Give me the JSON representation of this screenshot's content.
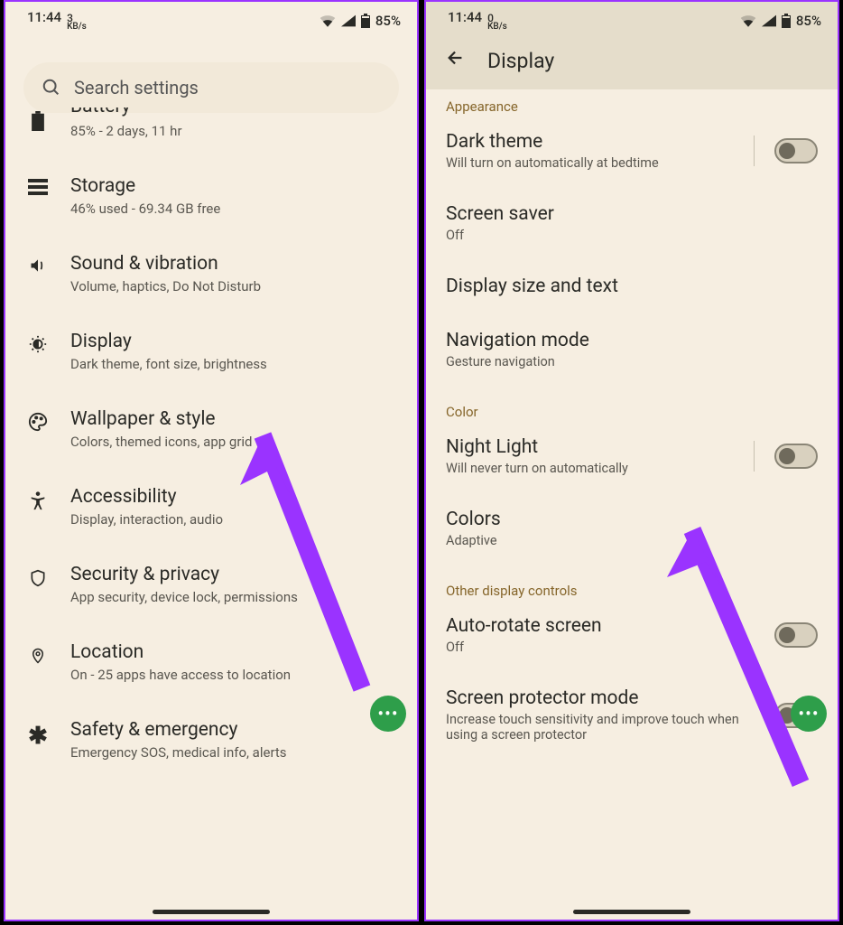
{
  "status": {
    "time": "11:44",
    "kbs_left": "3",
    "kbs_right": "0",
    "kbs_unit": "KB/s",
    "battery": "85%"
  },
  "left": {
    "search_placeholder": "Search settings",
    "items": [
      {
        "icon": "battery",
        "title": "Battery",
        "sub": "85% - 2 days, 11 hr"
      },
      {
        "icon": "storage",
        "title": "Storage",
        "sub": "46% used - 69.34 GB free"
      },
      {
        "icon": "sound",
        "title": "Sound & vibration",
        "sub": "Volume, haptics, Do Not Disturb"
      },
      {
        "icon": "display",
        "title": "Display",
        "sub": "Dark theme, font size, brightness"
      },
      {
        "icon": "wallpaper",
        "title": "Wallpaper & style",
        "sub": "Colors, themed icons, app grid"
      },
      {
        "icon": "accessibility",
        "title": "Accessibility",
        "sub": "Display, interaction, audio"
      },
      {
        "icon": "security",
        "title": "Security & privacy",
        "sub": "App security, device lock, permissions"
      },
      {
        "icon": "location",
        "title": "Location",
        "sub": "On - 25 apps have access to location"
      },
      {
        "icon": "safety",
        "title": "Safety & emergency",
        "sub": "Emergency SOS, medical info, alerts"
      }
    ]
  },
  "right": {
    "header": "Display",
    "sections": {
      "appearance": {
        "label": "Appearance",
        "items": [
          {
            "title": "Dark theme",
            "sub": "Will turn on automatically at bedtime",
            "toggle": true
          },
          {
            "title": "Screen saver",
            "sub": "Off"
          },
          {
            "title": "Display size and text",
            "sub": ""
          },
          {
            "title": "Navigation mode",
            "sub": "Gesture navigation"
          }
        ]
      },
      "color": {
        "label": "Color",
        "items": [
          {
            "title": "Night Light",
            "sub": "Will never turn on automatically",
            "toggle": true
          },
          {
            "title": "Colors",
            "sub": "Adaptive"
          }
        ]
      },
      "other": {
        "label": "Other display controls",
        "items": [
          {
            "title": "Auto-rotate screen",
            "sub": "Off",
            "toggle": true
          },
          {
            "title": "Screen protector mode",
            "sub": "Increase touch sensitivity and improve touch when using a screen protector",
            "toggle": true
          }
        ]
      }
    }
  }
}
